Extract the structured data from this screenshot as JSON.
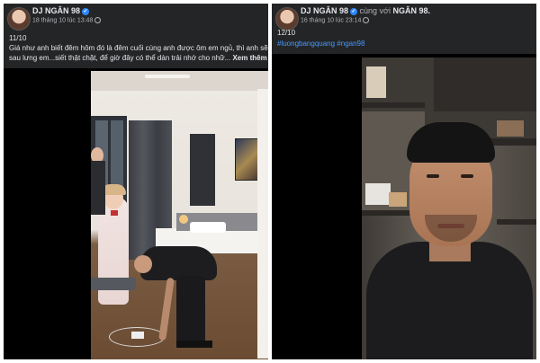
{
  "left_post": {
    "author": "DJ NGÂN 98",
    "verified_mark": "✓",
    "timestamp": "18 tháng 10 lúc 13:48",
    "date_line": "11/10",
    "caption_lines": [
      "Giá như anh biết đêm hôm đó là đêm cuối cùng anh được ôm em ngủ, thì anh sẽ",
      "sau lưng em...siết thật chặt, để giờ đây có thể dàn trải nhớ cho nhữ..."
    ],
    "see_more": "Xem thêm"
  },
  "right_post": {
    "author": "DJ NGÂN 98",
    "verified_mark": "✓",
    "with_text": "cùng với",
    "tagged": "NGÂN 98.",
    "timestamp": "16 tháng 10 lúc 23:14",
    "date_line": "12/10",
    "hashtags": "#luongbangquang #ngan98"
  },
  "icons": [
    "avatar",
    "verified-badge-icon",
    "globe-icon",
    "video-frame"
  ],
  "colors": {
    "header_bg": "#242526",
    "text_primary": "#e4e6eb",
    "text_secondary": "#b0b3b8",
    "link": "#4599ff",
    "verified": "#2d88ff"
  }
}
